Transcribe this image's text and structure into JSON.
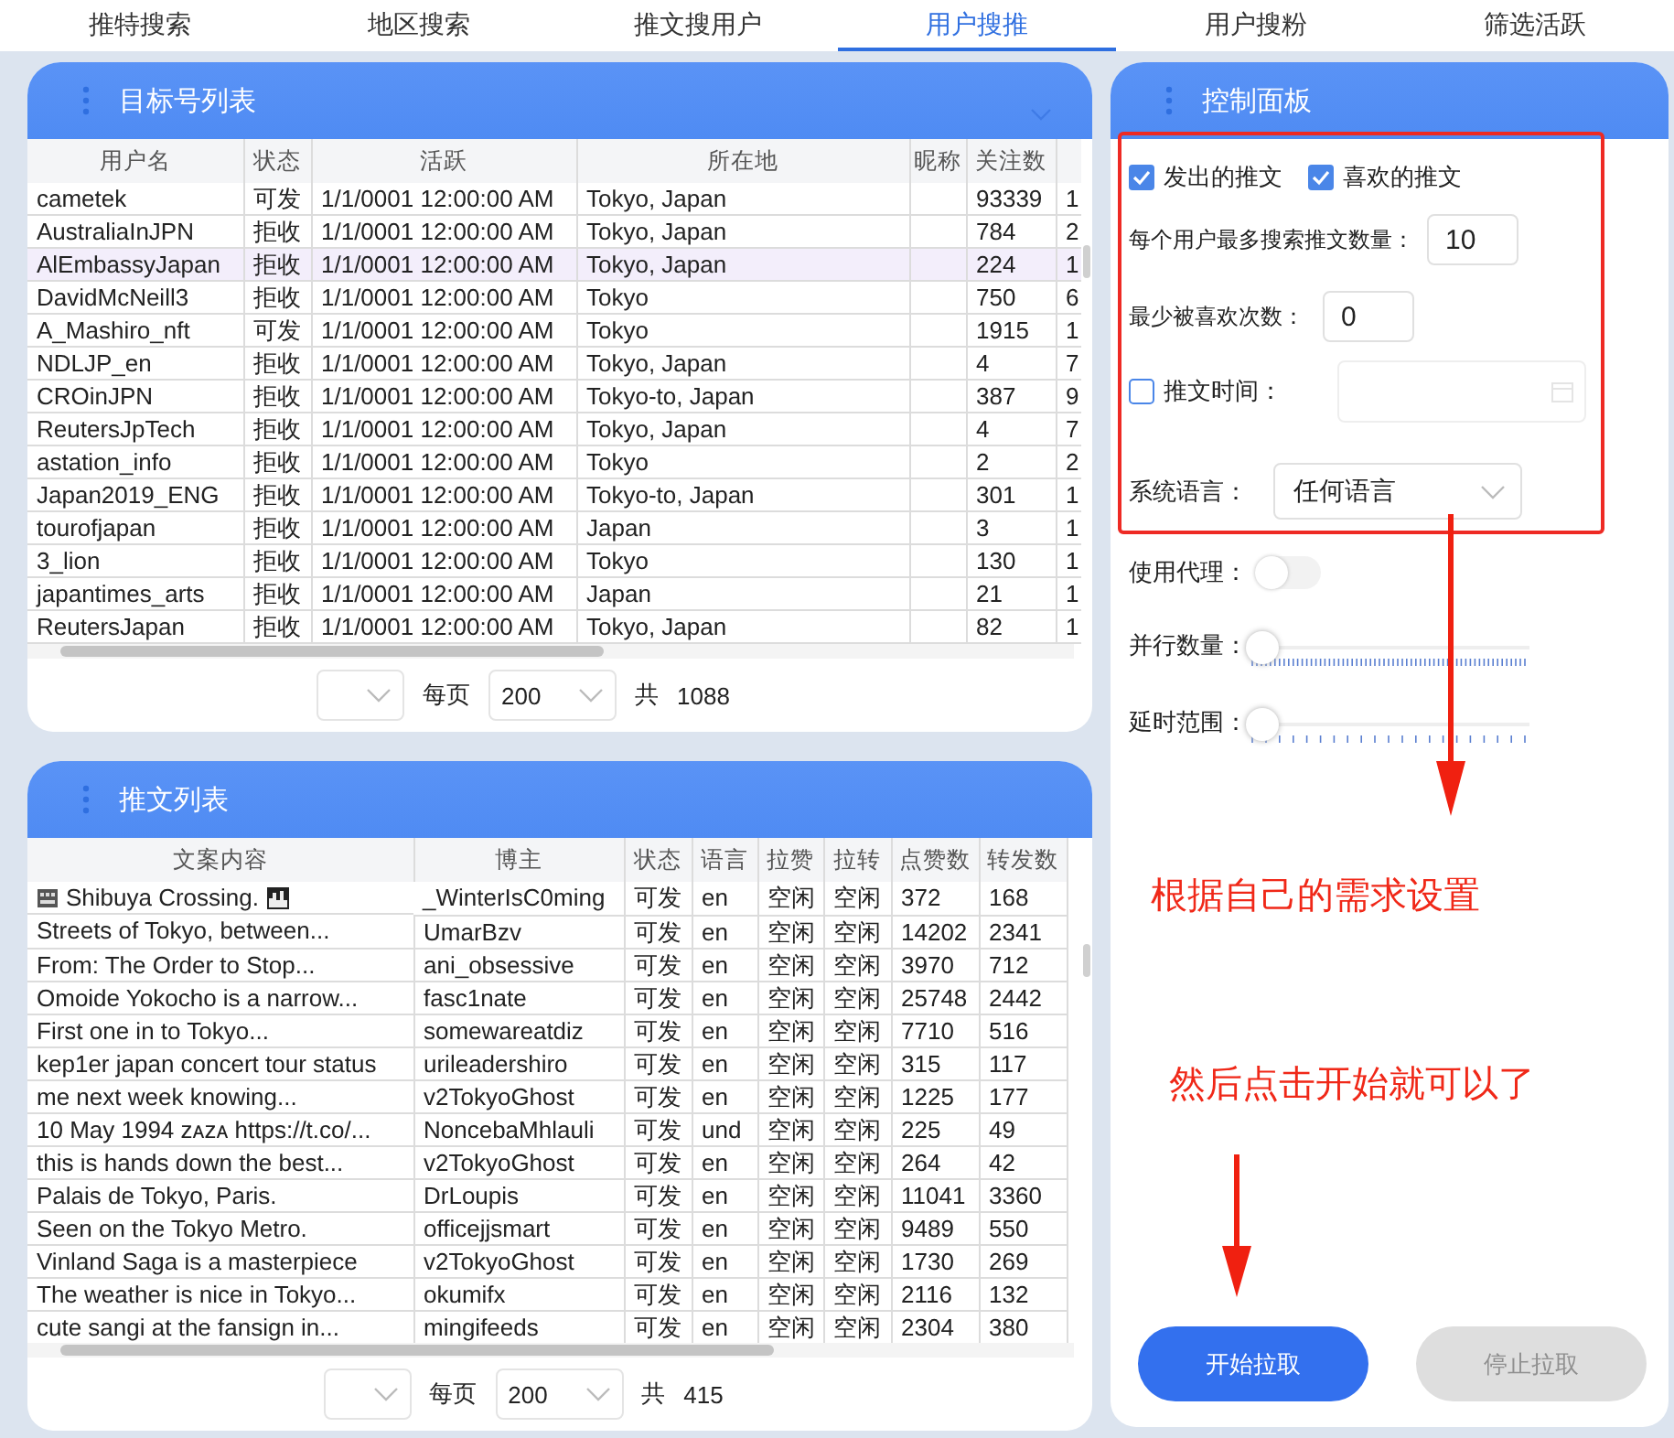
{
  "tabs": [
    {
      "label": "推特搜索",
      "selected": false
    },
    {
      "label": "地区搜索",
      "selected": false
    },
    {
      "label": "推文搜用户",
      "selected": false
    },
    {
      "label": "用户搜推",
      "selected": true
    },
    {
      "label": "用户搜粉",
      "selected": false
    },
    {
      "label": "筛选活跃",
      "selected": false
    }
  ],
  "target_panel": {
    "title": "目标号列表",
    "table": {
      "columns": [
        "用户名",
        "状态",
        "活跃",
        "所在地",
        "昵称",
        "关注数"
      ],
      "rows": [
        {
          "cells": [
            "cametek",
            "可发",
            "1/1/0001 12:00:00 AM",
            "Tokyo, Japan",
            "",
            "93339",
            "1"
          ],
          "selected": false
        },
        {
          "cells": [
            "AustraliaInJPN",
            "拒收",
            "1/1/0001 12:00:00 AM",
            "Tokyo, Japan",
            "",
            "784",
            "2"
          ],
          "selected": false
        },
        {
          "cells": [
            "AlEmbassyJapan",
            "拒收",
            "1/1/0001 12:00:00 AM",
            "Tokyo, Japan",
            "",
            "224",
            "1"
          ],
          "selected": true
        },
        {
          "cells": [
            "DavidMcNeill3",
            "拒收",
            "1/1/0001 12:00:00 AM",
            "Tokyo",
            "",
            "750",
            "6"
          ],
          "selected": false
        },
        {
          "cells": [
            "A_Mashiro_nft",
            "可发",
            "1/1/0001 12:00:00 AM",
            "Tokyo",
            "",
            "1915",
            "1"
          ],
          "selected": false
        },
        {
          "cells": [
            "NDLJP_en",
            "拒收",
            "1/1/0001 12:00:00 AM",
            "Tokyo, Japan",
            "",
            "4",
            "7"
          ],
          "selected": false
        },
        {
          "cells": [
            "CROinJPN",
            "拒收",
            "1/1/0001 12:00:00 AM",
            "Tokyo-to, Japan",
            "",
            "387",
            "9"
          ],
          "selected": false
        },
        {
          "cells": [
            "ReutersJpTech",
            "拒收",
            "1/1/0001 12:00:00 AM",
            "Tokyo, Japan",
            "",
            "4",
            "7"
          ],
          "selected": false
        },
        {
          "cells": [
            "astation_info",
            "拒收",
            "1/1/0001 12:00:00 AM",
            "Tokyo",
            "",
            "2",
            "2"
          ],
          "selected": false
        },
        {
          "cells": [
            "Japan2019_ENG",
            "拒收",
            "1/1/0001 12:00:00 AM",
            "Tokyo-to, Japan",
            "",
            "301",
            "1"
          ],
          "selected": false
        },
        {
          "cells": [
            "tourofjapan",
            "拒收",
            "1/1/0001 12:00:00 AM",
            "Japan",
            "",
            "3",
            "1"
          ],
          "selected": false
        },
        {
          "cells": [
            "3_lion",
            "拒收",
            "1/1/0001 12:00:00 AM",
            "Tokyo",
            "",
            "130",
            "1"
          ],
          "selected": false
        },
        {
          "cells": [
            "japantimes_arts",
            "拒收",
            "1/1/0001 12:00:00 AM",
            "Japan",
            "",
            "21",
            "1"
          ],
          "selected": false
        },
        {
          "cells": [
            "ReutersJapan",
            "拒收",
            "1/1/0001 12:00:00 AM",
            "Tokyo, Japan",
            "",
            "82",
            "1"
          ],
          "selected": false
        }
      ]
    },
    "pager": {
      "page_size": "200",
      "total_label": "共",
      "total": "1088",
      "per_page_label": "每页"
    }
  },
  "tweet_panel": {
    "title": "推文列表",
    "table": {
      "columns": [
        "文案内容",
        "博主",
        "状态",
        "语言",
        "拉赞",
        "拉转",
        "点赞数",
        "转发数"
      ],
      "rows": [
        {
          "cells": [
            "Shibuya Crossing.",
            "_WinterIsC0ming",
            "可发",
            "en",
            "空闲",
            "空闲",
            "372",
            "168"
          ],
          "selected": false,
          "decorated": true
        },
        {
          "cells": [
            "Streets of Tokyo, between...",
            "UmarBzv",
            "可发",
            "en",
            "空闲",
            "空闲",
            "14202",
            "2341"
          ],
          "selected": false,
          "decorated": false
        },
        {
          "cells": [
            "From: The Order to Stop...",
            "ani_obsessive",
            "可发",
            "en",
            "空闲",
            "空闲",
            "3970",
            "712"
          ],
          "selected": false,
          "decorated": false
        },
        {
          "cells": [
            "Omoide Yokocho is a narrow...",
            "fasc1nate",
            "可发",
            "en",
            "空闲",
            "空闲",
            "25748",
            "2442"
          ],
          "selected": false,
          "decorated": false
        },
        {
          "cells": [
            "First one in to Tokyo...",
            "somewareatdiz",
            "可发",
            "en",
            "空闲",
            "空闲",
            "7710",
            "516"
          ],
          "selected": false,
          "decorated": false
        },
        {
          "cells": [
            "kep1er japan concert tour status",
            "urileadershiro",
            "可发",
            "en",
            "空闲",
            "空闲",
            "315",
            "117"
          ],
          "selected": false,
          "decorated": false
        },
        {
          "cells": [
            "me next week knowing...",
            "v2TokyoGhost",
            "可发",
            "en",
            "空闲",
            "空闲",
            "1225",
            "177"
          ],
          "selected": false,
          "decorated": false
        },
        {
          "cells": [
            "10 May 1994 ᴢᴀᴢᴀ https://t.co/...",
            "NoncebaMhlauli",
            "可发",
            "und",
            "空闲",
            "空闲",
            "225",
            "49"
          ],
          "selected": false,
          "decorated": false
        },
        {
          "cells": [
            "this is hands down the best...",
            "v2TokyoGhost",
            "可发",
            "en",
            "空闲",
            "空闲",
            "264",
            "42"
          ],
          "selected": false,
          "decorated": false
        },
        {
          "cells": [
            "Palais de Tokyo, Paris.",
            "DrLoupis",
            "可发",
            "en",
            "空闲",
            "空闲",
            "11041",
            "3360"
          ],
          "selected": false,
          "decorated": false
        },
        {
          "cells": [
            "Seen on the Tokyo Metro.",
            "officejjsmart",
            "可发",
            "en",
            "空闲",
            "空闲",
            "9489",
            "550"
          ],
          "selected": false,
          "decorated": false
        },
        {
          "cells": [
            "Vinland Saga is a masterpiece",
            "v2TokyoGhost",
            "可发",
            "en",
            "空闲",
            "空闲",
            "1730",
            "269"
          ],
          "selected": false,
          "decorated": false
        },
        {
          "cells": [
            "The weather is nice in Tokyo...",
            "okumifx",
            "可发",
            "en",
            "空闲",
            "空闲",
            "2116",
            "132"
          ],
          "selected": false,
          "decorated": false
        },
        {
          "cells": [
            "cute sangi at the fansign in...",
            "mingifeeds",
            "可发",
            "en",
            "空闲",
            "空闲",
            "2304",
            "380"
          ],
          "selected": false,
          "decorated": false
        }
      ]
    },
    "pager": {
      "page_size": "200",
      "total_label": "共",
      "total": "415",
      "per_page_label": "每页"
    }
  },
  "control_panel": {
    "title": "控制面板",
    "post_types": [
      {
        "label": "发出的推文",
        "checked": true
      },
      {
        "label": "喜欢的推文",
        "checked": true
      }
    ],
    "max_tweets": {
      "label": "每个用户最多搜索推文数量：",
      "value": "10"
    },
    "min_likes": {
      "label": "最少被喜欢次数：",
      "value": "0"
    },
    "tweet_time": {
      "label": "推文时间：",
      "checked": false
    },
    "language": {
      "label": "系统语言：",
      "value": "任何语言"
    },
    "proxy": {
      "label": "使用代理：",
      "on": false
    },
    "sliders": [
      {
        "label": "并行数量：",
        "level": 0,
        "kind": "dense"
      },
      {
        "label": "延时范围：",
        "level": 0,
        "kind": "sparse"
      }
    ],
    "buttons": [
      {
        "label": "开始拉取",
        "disabled": false
      },
      {
        "label": "停止拉取",
        "disabled": true
      }
    ]
  },
  "annotations": [
    {
      "text": "根据自己的需求设置"
    },
    {
      "text": "然后点击开始就可以了"
    }
  ]
}
